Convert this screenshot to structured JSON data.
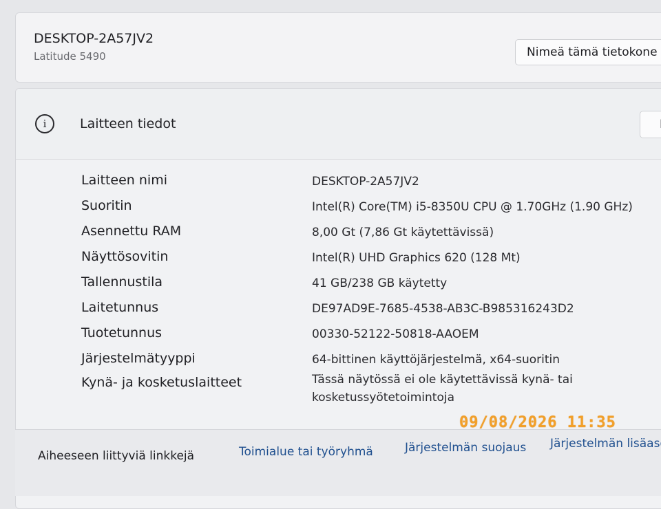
{
  "device": {
    "name": "DESKTOP-2A57JV2",
    "model": "Latitude 5490",
    "rename_button": "Nimeä tämä tietokone"
  },
  "device_info": {
    "title": "Laitteen tiedot",
    "icon": "info-icon",
    "copy_button": "Kop",
    "specs": [
      {
        "label": "Laitteen nimi",
        "value": "DESKTOP-2A57JV2"
      },
      {
        "label": "Suoritin",
        "value": "Intel(R) Core(TM) i5-8350U CPU @ 1.70GHz (1.90 GHz)"
      },
      {
        "label": "Asennettu RAM",
        "value": "8,00 Gt (7,86 Gt käytettävissä)"
      },
      {
        "label": "Näyttösovitin",
        "value": "Intel(R) UHD Graphics 620 (128 Mt)"
      },
      {
        "label": "Tallennustila",
        "value": "41 GB/238 GB käytetty"
      },
      {
        "label": "Laitetunnus",
        "value": "DE97AD9E-7685-4538-AB3C-B985316243D2"
      },
      {
        "label": "Tuotetunnus",
        "value": "00330-52122-50818-AAOEM"
      },
      {
        "label": "Järjestelmätyyppi",
        "value": "64-bittinen käyttöjärjestelmä, x64-suoritin"
      },
      {
        "label": "Kynä- ja kosketuslaitteet",
        "value_line1": "Tässä näytössä ei ole käytettävissä kynä- tai",
        "value_line2": "kosketussyötetoimintoja"
      }
    ]
  },
  "related_links": {
    "heading": "Aiheeseen liittyviä linkkejä",
    "links": [
      "Toimialue tai työryhmä",
      "Järjestelmän suojaus",
      "Järjestelmän lisäase"
    ]
  },
  "date_stamp": "09/08/2026 11:35",
  "colors": {
    "background": "#e6e7ea",
    "card": "#f3f3f5",
    "link": "#20508f",
    "date_stamp": "#f2a02a"
  }
}
